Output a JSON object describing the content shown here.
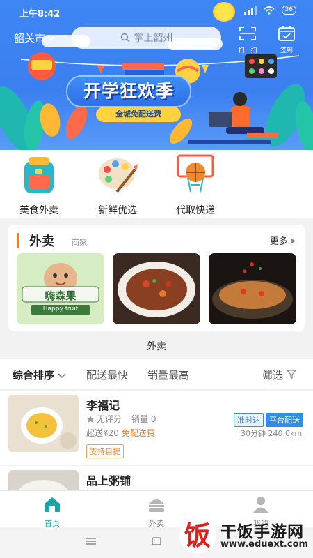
{
  "status_bar": {
    "time": "上午8:42",
    "signal": "4G",
    "wifi": "wifi",
    "battery": "36"
  },
  "header": {
    "city": "韶关市",
    "search_placeholder": "掌上韶州",
    "scan_label": "扫一扫",
    "checkin_label": "签到"
  },
  "banner": {
    "title": "开学狂欢季",
    "subtitle": "全城免配送费"
  },
  "quick_links": [
    {
      "label": "美食外卖",
      "icon": "backpack-icon"
    },
    {
      "label": "新鲜优选",
      "icon": "palette-icon"
    },
    {
      "label": "代取快递",
      "icon": "basketball-icon"
    }
  ],
  "takeaway_card": {
    "title": "外卖",
    "subtitle": "商家",
    "more": "更多",
    "thumbs": [
      {
        "text": "嗨森果",
        "sub": "Happy fruit"
      },
      {
        "text": ""
      },
      {
        "text": ""
      }
    ],
    "caption": "外卖"
  },
  "sort_bar": {
    "options": [
      "综合排序",
      "配送最快",
      "销量最高"
    ],
    "filter": "筛选"
  },
  "shops": [
    {
      "name": "李福记",
      "rating": "无评分",
      "sales": "销量 0",
      "min_order": "起送¥20",
      "delivery": "免配送费",
      "eta": "30分钟 240.0km",
      "tags": [
        "准时达",
        "平台配送"
      ],
      "badge": "支持自提"
    },
    {
      "name": "品上粥铺"
    }
  ],
  "tabs": [
    {
      "label": "首页",
      "icon": "home-icon",
      "active": true
    },
    {
      "label": "外卖",
      "icon": "burger-icon",
      "active": false
    },
    {
      "label": "我的",
      "icon": "user-icon",
      "active": false
    }
  ],
  "watermark": {
    "title": "干饭手游网",
    "url": "www.eduext.com",
    "logo_char": "饭"
  },
  "colors": {
    "primary": "#3f86f5",
    "accent_orange": "#f07c1d",
    "tab_active": "#1aa5a0",
    "tag_blue": "#2e8ee8"
  }
}
